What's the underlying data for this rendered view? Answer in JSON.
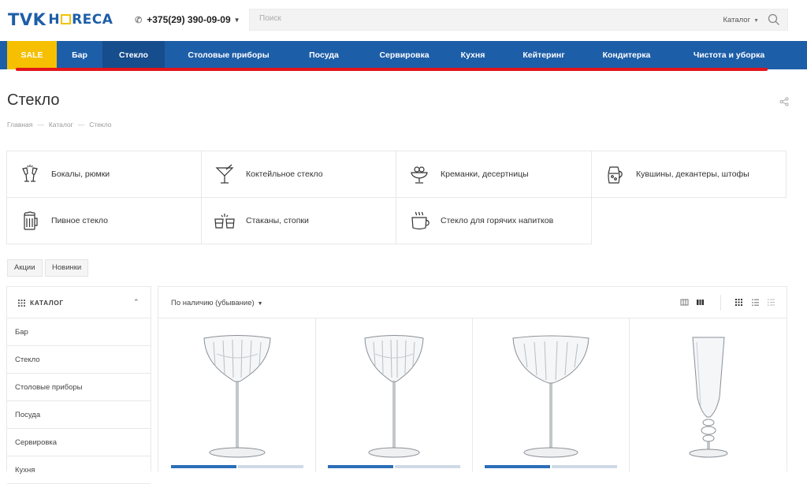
{
  "header": {
    "logo_main": "TVK",
    "logo_sub_left": "H",
    "logo_sub_right": "RECA",
    "phone": "+375(29) 390-09-09",
    "search_placeholder": "Поиск",
    "search_scope": "Каталог"
  },
  "nav": {
    "items": [
      "SALE",
      "Бар",
      "Стекло",
      "Столовые приборы",
      "Посуда",
      "Сервировка",
      "Кухня",
      "Кейтеринг",
      "Кондитерка",
      "Чистота и уборка"
    ]
  },
  "page": {
    "title": "Стекло",
    "breadcrumbs": [
      "Главная",
      "Каталог",
      "Стекло"
    ]
  },
  "categories": [
    {
      "label": "Бокалы, рюмки",
      "icon": "glasses-icon"
    },
    {
      "label": "Коктейльное стекло",
      "icon": "cocktail-icon"
    },
    {
      "label": "Креманки, десертницы",
      "icon": "dessert-icon"
    },
    {
      "label": "Кувшины, декантеры, штофы",
      "icon": "jug-icon"
    },
    {
      "label": "Пивное стекло",
      "icon": "beer-icon"
    },
    {
      "label": "Стаканы, стопки",
      "icon": "tumblers-icon"
    },
    {
      "label": "Стекло для горячих напитков",
      "icon": "hot-drink-icon"
    }
  ],
  "tags": [
    "Акции",
    "Новинки"
  ],
  "sidebar": {
    "title": "КАТАЛОГ",
    "items": [
      "Бар",
      "Стекло",
      "Столовые приборы",
      "Посуда",
      "Сервировка",
      "Кухня"
    ]
  },
  "sort": {
    "label": "По наличию (убывание)"
  },
  "colors": {
    "brand_blue": "#1d5ea8",
    "sale_yellow": "#f6c000",
    "accent_red": "#e2141b"
  }
}
